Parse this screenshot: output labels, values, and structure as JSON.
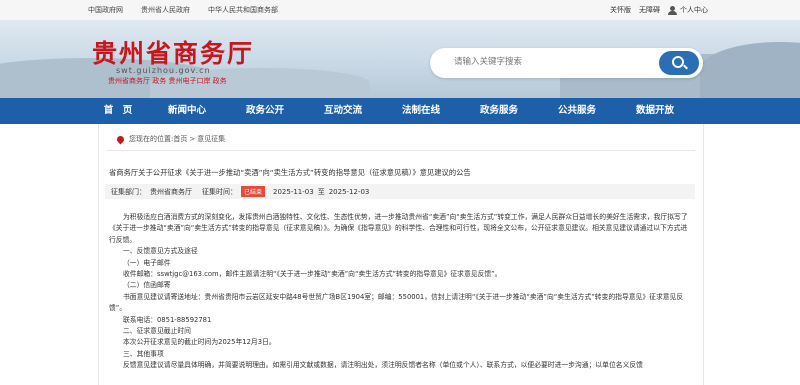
{
  "topbar": {
    "links": [
      "中国政府网",
      "贵州省人民政府",
      "中华人民共和国商务部"
    ],
    "edition": "关怀版",
    "accessibility": "无障碍",
    "user_center": "个人中心"
  },
  "header": {
    "title": "贵州省商务厅",
    "domain": "swt.guizhou.gov.cn",
    "subtitle": "贵州省商务厅 政务 贵州电子口岸 政务",
    "search_placeholder": "请输入关键字搜索"
  },
  "nav": {
    "items": [
      "首　页",
      "新闻中心",
      "政务公开",
      "互动交流",
      "法制在线",
      "政务服务",
      "公共服务",
      "数据开放"
    ]
  },
  "breadcrumb": {
    "prefix": "您现在的位置:",
    "home": "首页",
    "sep": ">",
    "current": "意见征集"
  },
  "article": {
    "title": "省商务厅关于公开征求《关于进一步推动“卖酒”向“卖生活方式”转变的指导意见（征求意见稿）》意见建议的公告",
    "dept_label": "征集部门：",
    "dept": "贵州省商务厅",
    "time_label": "征集时间：",
    "status": "已结束",
    "start": "2025-11-03",
    "to": "至",
    "end": "2025-12-03",
    "paragraphs": [
      "为积极适应白酒消费方式的深刻变化，发挥贵州白酒独特性、文化性、生态性优势，进一步推动贵州省“卖酒”向“卖生活方式”转变工作，满足人民群众日益增长的美好生活需求，我厅拟写了《关于进一步推动“卖酒”向“卖生活方式”转变的指导意见（征求意见稿）》。为确保《指导意见》的科学性、合理性和可行性，现将全文公布，公开征求意见建议。相关意见建议请通过以下方式进行反馈。",
      "一、反馈意见方式及途径",
      "（一）电子邮件",
      "收件邮箱：sswtjgc@163.com，邮件主题请注明“《关于进一步推动“卖酒”向“卖生活方式”转变的指导意见》征求意见反馈”。",
      "（二）信函邮寄",
      "书面意见建议请寄送地址：贵州省贵阳市云岩区延安中路48号世贸广场B区1904室；邮编：550001，信封上请注明“《关于进一步推动“卖酒”向“卖生活方式”转变的指导意见》征求意见反馈”。",
      "联系电话：0851-88592781",
      "二、征求意见截止时间",
      "本次公开征求意见的截止时间为2025年12月3日。",
      "三、其他事项",
      "反馈意见建议请尽量具体明确，并简要说明理由。如需引用文献或数据，请注明出处，须注明反馈者名称（单位或个人）、联系方式，以便必要时进一步沟通；以单位名义反馈"
    ]
  },
  "colors": {
    "brand_red": "#c8161d",
    "nav_blue": "#1d5fa8",
    "status_red": "#e84a3a"
  }
}
